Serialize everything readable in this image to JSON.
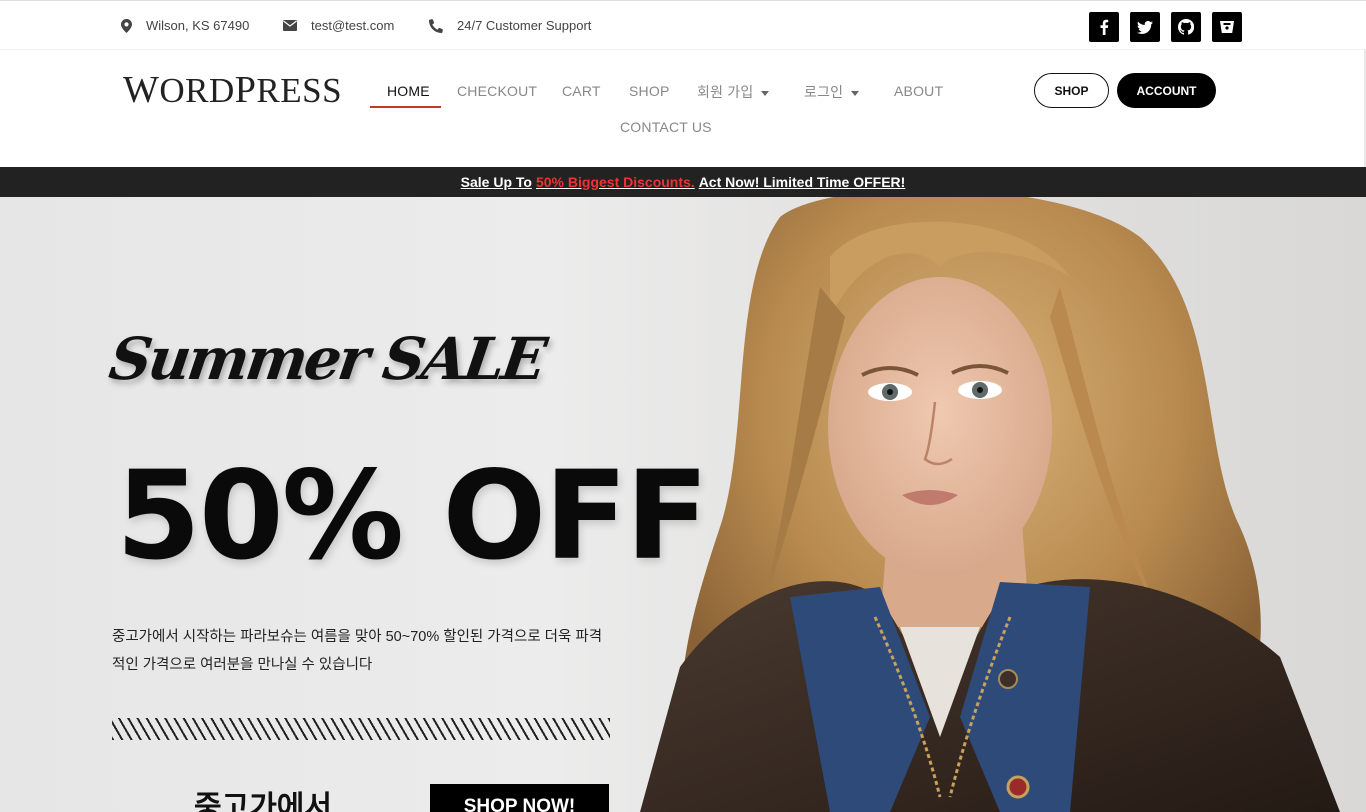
{
  "topbar": {
    "address": "Wilson, KS 67490",
    "email": "test@test.com",
    "support": "24/7 Customer Support",
    "social_icons": [
      "facebook-icon",
      "twitter-icon",
      "github-icon",
      "bucket-icon"
    ]
  },
  "header": {
    "logo_w": "W",
    "logo_ord": "ORD",
    "logo_p": "P",
    "logo_ress": "RESS",
    "nav": {
      "home": "HOME",
      "checkout": "CHECKOUT",
      "cart": "CART",
      "shop": "SHOP",
      "signup": "회원 가입",
      "login": "로그인",
      "about": "ABOUT",
      "contact": "CONTACT US"
    },
    "shop_button": "SHOP",
    "account_button": "ACCOUNT"
  },
  "salebar": {
    "prefix": "Sale Up To",
    "highlight": "50% Biggest Discounts.",
    "suffix": "Act Now! Limited Time OFFER!"
  },
  "hero": {
    "script_title": "Summer SALE",
    "headline": "50% OFF",
    "description": "중고가에서 시작하는 파라보슈는 여름을 맞아 50~70% 할인된 가격으로 더욱 파격적인 가격으로 여러분을 만나실 수 있습니다",
    "subheading": "중고가에서",
    "cta": "SHOP NOW!"
  },
  "colors": {
    "accent_red": "#e33333",
    "dark": "#000000",
    "salebar_bg": "#222222"
  }
}
